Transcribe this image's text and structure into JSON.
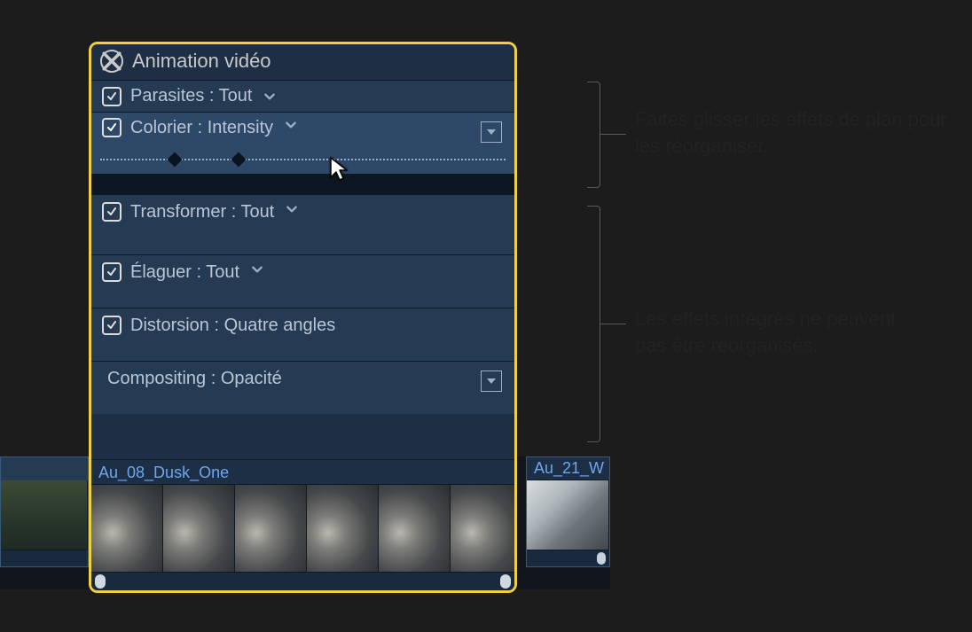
{
  "panel": {
    "title": "Animation vidéo",
    "rows": [
      {
        "label": "Parasites : Tout",
        "checked": true,
        "hasChevron": true,
        "hasDisclosure": false
      },
      {
        "label": "Colorier : Intensity",
        "checked": true,
        "hasChevron": true,
        "hasDisclosure": true,
        "selected": true
      },
      {
        "label": "Transformer : Tout",
        "checked": true,
        "hasChevron": true,
        "hasDisclosure": false
      },
      {
        "label": "Élaguer : Tout",
        "checked": true,
        "hasChevron": true,
        "hasDisclosure": false
      },
      {
        "label": "Distorsion : Quatre angles",
        "checked": true,
        "hasChevron": false,
        "hasDisclosure": false
      },
      {
        "label": "Compositing : Opacité",
        "checked": false,
        "hasChevron": false,
        "hasDisclosure": true
      }
    ],
    "clip_title": "Au_08_Dusk_One"
  },
  "timeline": {
    "right_clip_title": "Au_21_W"
  },
  "callouts": {
    "top": "Faites glisser les effets de plan pour les réorganiser.",
    "bottom": "Les effets intégrés ne peuvent pas être réorganisés."
  }
}
